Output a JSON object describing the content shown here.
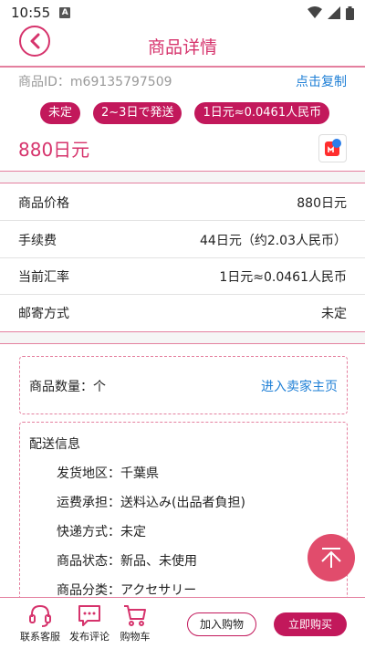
{
  "status_bar": {
    "time": "10:55",
    "sim_letter": "A"
  },
  "header": {
    "title": "商品详情"
  },
  "product": {
    "id_label": "商品ID：m69135797509",
    "copy_label": "点击复制",
    "tags": [
      "未定",
      "2~3日で発送",
      "1日元≈0.0461人民币"
    ],
    "price": "880日元"
  },
  "details": [
    {
      "label": "商品价格",
      "value": "880日元"
    },
    {
      "label": "手续费",
      "value": "44日元（约2.03人民币）"
    },
    {
      "label": "当前汇率",
      "value": "1日元≈0.0461人民币"
    },
    {
      "label": "邮寄方式",
      "value": "未定"
    }
  ],
  "quantity": {
    "label": "商品数量：个",
    "seller_link": "进入卖家主页"
  },
  "shipping": {
    "title": "配送信息",
    "items": [
      "发货地区：千葉県",
      "运费承担：送料込み(出品者負担)",
      "快递方式：未定",
      "商品状态：新品、未使用",
      "商品分类：アクセサリー"
    ]
  },
  "bottom_bar": {
    "service": "联系客服",
    "comment": "发布评论",
    "cart": "购物车",
    "add_cart": "加入购物",
    "buy_now": "立即购买"
  },
  "colors": {
    "accent": "#c2185b",
    "title": "#d6336c",
    "link": "#1e7fd6"
  }
}
